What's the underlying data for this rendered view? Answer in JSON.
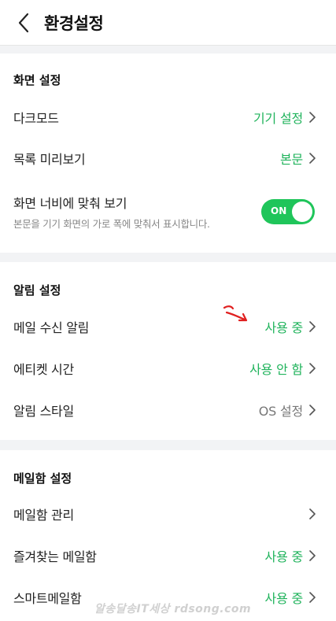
{
  "header": {
    "title": "환경설정"
  },
  "sections": [
    {
      "title": "화면 설정",
      "rows": [
        {
          "label": "다크모드",
          "value": "기기 설정"
        },
        {
          "label": "목록 미리보기",
          "value": "본문"
        },
        {
          "label": "화면 너비에 맞춰 보기",
          "sub": "본문을 기기 화면의 가로 폭에 맞춰서 표시합니다.",
          "toggle": "ON",
          "toggle_state": true
        }
      ]
    },
    {
      "title": "알림 설정",
      "rows": [
        {
          "label": "메일 수신 알림",
          "value": "사용 중"
        },
        {
          "label": "에티켓 시간",
          "value": "사용 안 함"
        },
        {
          "label": "알림 스타일",
          "value": "OS 설정"
        }
      ]
    },
    {
      "title": "메일함 설정",
      "rows": [
        {
          "label": "메일함 관리",
          "value": ""
        },
        {
          "label": "즐겨찾는 메일함",
          "value": "사용 중"
        },
        {
          "label": "스마트메일함",
          "value": "사용 중"
        }
      ]
    }
  ],
  "watermark": "알송달송IT세상 rdsong.com",
  "colors": {
    "accent": "#1fb35b",
    "toggle_on": "#1fc55a",
    "annotation": "#e02020",
    "background": "#f2f3f5"
  },
  "icons": {
    "back": "chevron-left-icon",
    "row_arrow": "chevron-right-icon"
  }
}
